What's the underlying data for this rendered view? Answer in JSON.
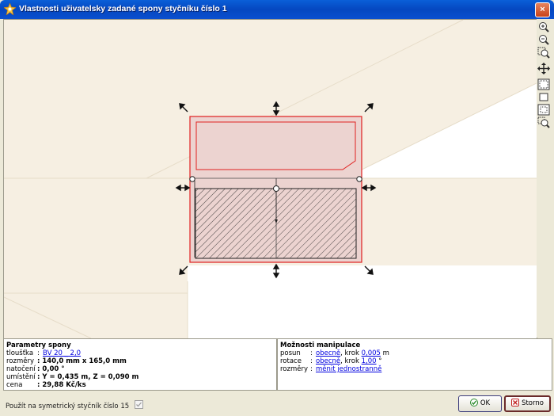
{
  "window": {
    "title": "Vlastnosti uživatelsky zadané spony styčníku číslo 1",
    "close_glyph": "×"
  },
  "colors": {
    "title_bar": "#0a5fd8",
    "plate_fill": "#ecd3d0",
    "plate_stroke": "#e02020",
    "background_beam": "#f6efe2"
  },
  "toolbar": {
    "icons": [
      "zoom-in-icon",
      "zoom-out-icon",
      "zoom-window-icon",
      "pan-icon",
      "fit-all-icon",
      "fit-selection-icon",
      "zoom-extents-icon",
      "zoom-previous-icon"
    ]
  },
  "params": {
    "title": "Parametry spony",
    "thickness_label": "tloušťka",
    "thickness_value": "BV 20 _ 2,0",
    "dims_label": "rozměry",
    "dims_value": ": 140,0 mm x 165,0 mm",
    "rotation_label": "natočení",
    "rotation_value": ": 0,00 °",
    "placement_label": "umístění",
    "placement_value": ": Y = 0,435 m, Z = 0,090 m",
    "price_label": "cena",
    "price_value": ": 29,88 Kč/ks"
  },
  "manipulation": {
    "title": "Možnosti manipulace",
    "move_label": "posun",
    "move_mode": "obecně",
    "move_step_text": ", krok",
    "move_step": "0,005",
    "move_unit": "m",
    "rotate_label": "rotace",
    "rotate_mode": "obecně",
    "rotate_step_text": ", krok",
    "rotate_step": "1,00",
    "rotate_unit": "°",
    "size_label": "rozměry",
    "size_mode": "měnit jednostranně"
  },
  "footer": {
    "symmetric_label": "Použít na symetrický styčník číslo 15",
    "symmetric_checked": true,
    "ok_label": "OK",
    "cancel_label": "Storno"
  }
}
